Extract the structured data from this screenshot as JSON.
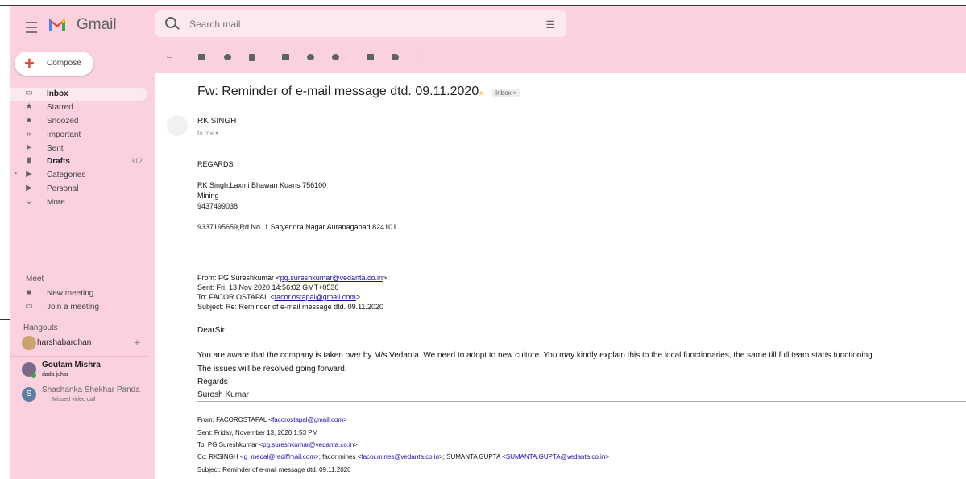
{
  "header": {
    "app_name": "Gmail",
    "search_placeholder": "Search mail"
  },
  "compose_label": "Compose",
  "sidebar": {
    "items": [
      {
        "label": "Inbox",
        "count": ""
      },
      {
        "label": "Starred",
        "count": ""
      },
      {
        "label": "Snoozed",
        "count": ""
      },
      {
        "label": "Important",
        "count": ""
      },
      {
        "label": "Sent",
        "count": ""
      },
      {
        "label": "Drafts",
        "count": "312"
      },
      {
        "label": "Categories",
        "count": ""
      },
      {
        "label": "Personal",
        "count": ""
      },
      {
        "label": "More",
        "count": ""
      }
    ],
    "meet": {
      "title": "Meet",
      "new_meeting": "New meeting",
      "join_meeting": "Join a meeting"
    },
    "hangouts": {
      "title": "Hangouts",
      "contacts": [
        {
          "name": "harshabardhan",
          "status": ""
        },
        {
          "name": "Goutam Mishra",
          "status": "dada juhar"
        },
        {
          "name": "Shashanka Shekhar Panda",
          "status": "Missed video call",
          "initial": "S"
        }
      ]
    }
  },
  "email": {
    "subject": "Fw: Reminder of e-mail message dtd. 09.11.2020",
    "label": "Inbox ×",
    "sender": "RK SINGH",
    "to": "to me ▾",
    "body": [
      "REGARDS.",
      "RK Singh,Laxmi Bhawan Kuans 756100",
      "Mining",
      "9437499038",
      "9337195659,Rd No. 1 Satyendra Nagar Auranagabad 824101"
    ],
    "fwd1": {
      "from_prefix": "From: PG Sureshkumar <",
      "from_email": "pg.sureshkumar@vedanta.co.in",
      "from_suffix": ">",
      "sent": "Sent: Fri, 13 Nov 2020 14:56:02 GMT+0530",
      "to_prefix": "To: FACOR OSTAPAL <",
      "to_email": "facor.ostapal@gmail.com",
      "to_suffix": ">",
      "subject": "Subject: Re: Reminder of e-mail message dtd. 09.11.2020"
    },
    "reply": {
      "greeting": "DearSir",
      "line1": "You are aware that the company is taken over by M/s Vedanta.  We need to adopt to new culture.  You may kindly explain this to the local functionaries, the same till full team starts functioning.",
      "line2": "The issues will be resolved going forward.",
      "regards": "Regards",
      "name": "Suresh Kumar"
    },
    "fwd2": {
      "from_prefix": "From: FACOROSTAPAL <",
      "from_email": "facorostapal@gmail.com",
      "from_suffix": ">",
      "sent": "Sent: Friday, November 13, 2020 1:53 PM",
      "to_prefix": "To: PG Sureshkumar <",
      "to_email": "pg.sureshkumar@vedanta.co.in",
      "to_suffix": ">",
      "cc_prefix": "Cc: RKSINGH <",
      "cc_email1": "g_medal@rediffmail.com",
      "cc_mid1": ">; facor mines <",
      "cc_email2": "facor.mines@vedanta.co.in",
      "cc_mid2": ">; SUMANTA GUPTA <",
      "cc_email3": "SUMANTA.GUPTA@vedanta.co.in",
      "cc_suffix": ">",
      "subject": "Subject: Reminder of e-mail message dtd. 09.11.2020"
    }
  },
  "colors": {
    "background": "#fad1dd",
    "pane": "#ffffff",
    "link": "#1a0dab",
    "important": "#f4b400"
  }
}
